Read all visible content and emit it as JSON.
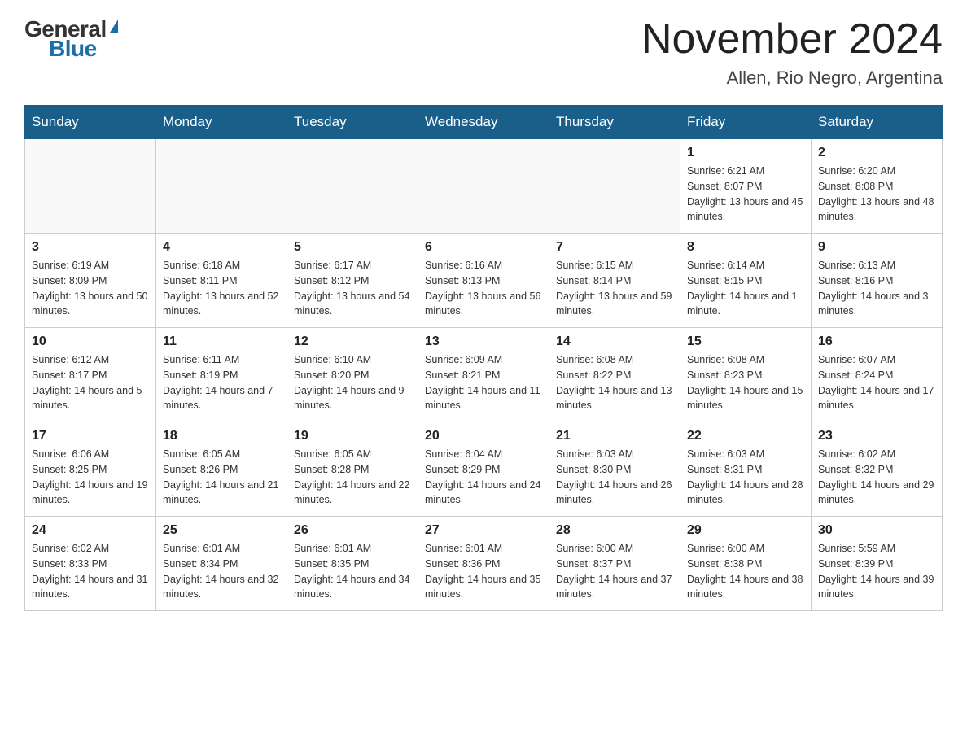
{
  "header": {
    "logo_general": "General",
    "logo_blue": "Blue",
    "month_title": "November 2024",
    "location": "Allen, Rio Negro, Argentina"
  },
  "days_of_week": [
    "Sunday",
    "Monday",
    "Tuesday",
    "Wednesday",
    "Thursday",
    "Friday",
    "Saturday"
  ],
  "weeks": [
    [
      {
        "day": "",
        "info": ""
      },
      {
        "day": "",
        "info": ""
      },
      {
        "day": "",
        "info": ""
      },
      {
        "day": "",
        "info": ""
      },
      {
        "day": "",
        "info": ""
      },
      {
        "day": "1",
        "info": "Sunrise: 6:21 AM\nSunset: 8:07 PM\nDaylight: 13 hours and 45 minutes."
      },
      {
        "day": "2",
        "info": "Sunrise: 6:20 AM\nSunset: 8:08 PM\nDaylight: 13 hours and 48 minutes."
      }
    ],
    [
      {
        "day": "3",
        "info": "Sunrise: 6:19 AM\nSunset: 8:09 PM\nDaylight: 13 hours and 50 minutes."
      },
      {
        "day": "4",
        "info": "Sunrise: 6:18 AM\nSunset: 8:11 PM\nDaylight: 13 hours and 52 minutes."
      },
      {
        "day": "5",
        "info": "Sunrise: 6:17 AM\nSunset: 8:12 PM\nDaylight: 13 hours and 54 minutes."
      },
      {
        "day": "6",
        "info": "Sunrise: 6:16 AM\nSunset: 8:13 PM\nDaylight: 13 hours and 56 minutes."
      },
      {
        "day": "7",
        "info": "Sunrise: 6:15 AM\nSunset: 8:14 PM\nDaylight: 13 hours and 59 minutes."
      },
      {
        "day": "8",
        "info": "Sunrise: 6:14 AM\nSunset: 8:15 PM\nDaylight: 14 hours and 1 minute."
      },
      {
        "day": "9",
        "info": "Sunrise: 6:13 AM\nSunset: 8:16 PM\nDaylight: 14 hours and 3 minutes."
      }
    ],
    [
      {
        "day": "10",
        "info": "Sunrise: 6:12 AM\nSunset: 8:17 PM\nDaylight: 14 hours and 5 minutes."
      },
      {
        "day": "11",
        "info": "Sunrise: 6:11 AM\nSunset: 8:19 PM\nDaylight: 14 hours and 7 minutes."
      },
      {
        "day": "12",
        "info": "Sunrise: 6:10 AM\nSunset: 8:20 PM\nDaylight: 14 hours and 9 minutes."
      },
      {
        "day": "13",
        "info": "Sunrise: 6:09 AM\nSunset: 8:21 PM\nDaylight: 14 hours and 11 minutes."
      },
      {
        "day": "14",
        "info": "Sunrise: 6:08 AM\nSunset: 8:22 PM\nDaylight: 14 hours and 13 minutes."
      },
      {
        "day": "15",
        "info": "Sunrise: 6:08 AM\nSunset: 8:23 PM\nDaylight: 14 hours and 15 minutes."
      },
      {
        "day": "16",
        "info": "Sunrise: 6:07 AM\nSunset: 8:24 PM\nDaylight: 14 hours and 17 minutes."
      }
    ],
    [
      {
        "day": "17",
        "info": "Sunrise: 6:06 AM\nSunset: 8:25 PM\nDaylight: 14 hours and 19 minutes."
      },
      {
        "day": "18",
        "info": "Sunrise: 6:05 AM\nSunset: 8:26 PM\nDaylight: 14 hours and 21 minutes."
      },
      {
        "day": "19",
        "info": "Sunrise: 6:05 AM\nSunset: 8:28 PM\nDaylight: 14 hours and 22 minutes."
      },
      {
        "day": "20",
        "info": "Sunrise: 6:04 AM\nSunset: 8:29 PM\nDaylight: 14 hours and 24 minutes."
      },
      {
        "day": "21",
        "info": "Sunrise: 6:03 AM\nSunset: 8:30 PM\nDaylight: 14 hours and 26 minutes."
      },
      {
        "day": "22",
        "info": "Sunrise: 6:03 AM\nSunset: 8:31 PM\nDaylight: 14 hours and 28 minutes."
      },
      {
        "day": "23",
        "info": "Sunrise: 6:02 AM\nSunset: 8:32 PM\nDaylight: 14 hours and 29 minutes."
      }
    ],
    [
      {
        "day": "24",
        "info": "Sunrise: 6:02 AM\nSunset: 8:33 PM\nDaylight: 14 hours and 31 minutes."
      },
      {
        "day": "25",
        "info": "Sunrise: 6:01 AM\nSunset: 8:34 PM\nDaylight: 14 hours and 32 minutes."
      },
      {
        "day": "26",
        "info": "Sunrise: 6:01 AM\nSunset: 8:35 PM\nDaylight: 14 hours and 34 minutes."
      },
      {
        "day": "27",
        "info": "Sunrise: 6:01 AM\nSunset: 8:36 PM\nDaylight: 14 hours and 35 minutes."
      },
      {
        "day": "28",
        "info": "Sunrise: 6:00 AM\nSunset: 8:37 PM\nDaylight: 14 hours and 37 minutes."
      },
      {
        "day": "29",
        "info": "Sunrise: 6:00 AM\nSunset: 8:38 PM\nDaylight: 14 hours and 38 minutes."
      },
      {
        "day": "30",
        "info": "Sunrise: 5:59 AM\nSunset: 8:39 PM\nDaylight: 14 hours and 39 minutes."
      }
    ]
  ]
}
